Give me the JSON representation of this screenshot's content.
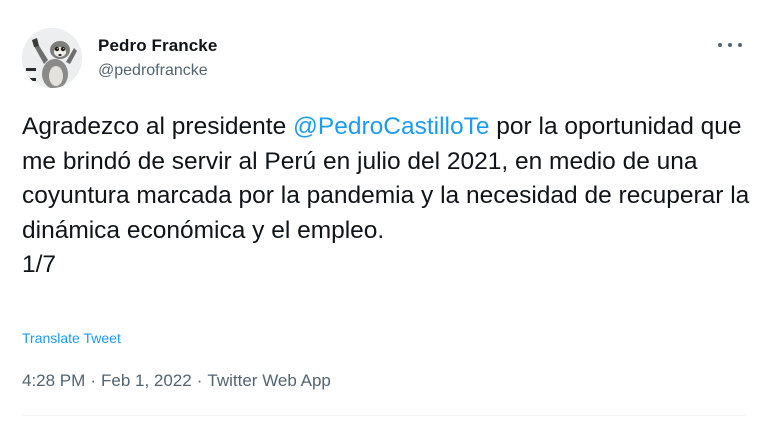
{
  "author": {
    "name": "Pedro Francke",
    "handle": "@pedrofrancke"
  },
  "tweet": {
    "text_before": "Agradezco al presidente ",
    "mention": "@PedroCastilloTe",
    "text_after": " por la oportunidad que me brindó de servir al Perú en julio del 2021, en medio de una coyuntura marcada por la pandemia y la necesidad de recuperar la dinámica económica y el empleo.",
    "thread_counter": "1/7",
    "translate_label": "Translate Tweet"
  },
  "meta": {
    "time": "4:28 PM",
    "separator": "·",
    "date": "Feb 1, 2022",
    "source": "Twitter Web App"
  },
  "colors": {
    "link": "#1d9bf0",
    "text": "#0f1419",
    "secondary": "#536471"
  },
  "icons": {
    "avatar": "lemur-avatar-icon",
    "more": "more-options-icon"
  }
}
